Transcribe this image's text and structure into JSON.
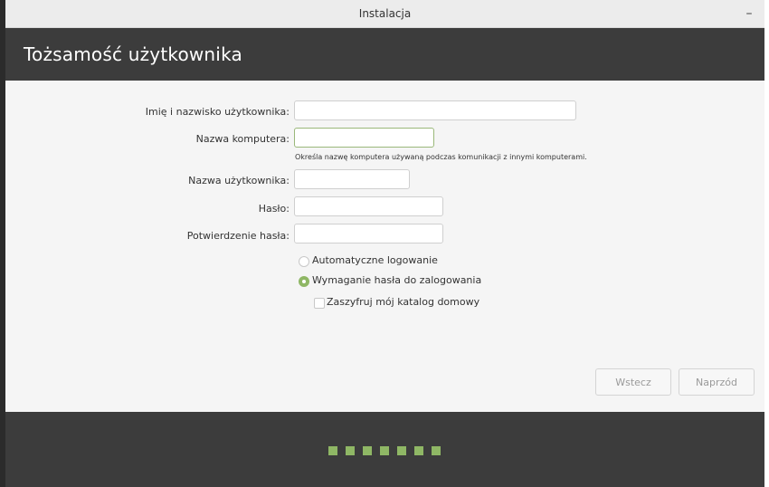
{
  "window": {
    "title": "Instalacja",
    "minimize_glyph": "–"
  },
  "header": {
    "heading": "Tożsamość użytkownika"
  },
  "form": {
    "full_name": {
      "label": "Imię i nazwisko użytkownika:",
      "value": ""
    },
    "computer_name": {
      "label": "Nazwa komputera:",
      "value": "",
      "hint": "Określa nazwę komputera używaną podczas komunikacji z innymi komputerami."
    },
    "username": {
      "label": "Nazwa użytkownika:",
      "value": ""
    },
    "password": {
      "label": "Hasło:",
      "value": ""
    },
    "password_confirm": {
      "label": "Potwierdzenie hasła:",
      "value": ""
    }
  },
  "login_options": {
    "auto_login": {
      "label": "Automatyczne logowanie",
      "checked": false
    },
    "require_password": {
      "label": "Wymaganie hasła do zalogowania",
      "checked": true
    },
    "encrypt_home": {
      "label": "Zaszyfruj mój katalog domowy",
      "checked": false
    }
  },
  "buttons": {
    "back": "Wstecz",
    "forward": "Naprzód"
  },
  "progress": {
    "steps_total": 7,
    "accent_color": "#8fb765"
  },
  "colors": {
    "header_bg": "#3c3c3c",
    "accent": "#8fb765"
  }
}
